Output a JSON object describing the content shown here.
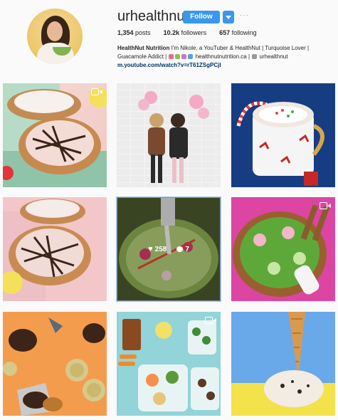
{
  "profile": {
    "username": "urhealthnut",
    "follow_label": "Follow",
    "more_label": "···",
    "stats": {
      "posts_count": "1,354",
      "posts_label": "posts",
      "followers_count": "10.2k",
      "followers_label": "followers",
      "following_count": "657",
      "following_label": "following"
    },
    "bio": {
      "name": "HealthNut Nutrition",
      "line1": "I'm Nikole, a YouTuber & HealthNut | Turquoise Lover |",
      "line2a": "Guacamole Addict |",
      "line2b": "healthnutnutrition.ca |",
      "line2c": "urhealthnut",
      "link": "m.youtube.com/watch?v=rT61ZSgPCjI"
    }
  },
  "hover_post": {
    "likes": "258",
    "comments": "7"
  },
  "colors": {
    "follow_blue": "#3897f0",
    "link_blue": "#003569"
  },
  "icons": [
    "video-icon",
    "heart-icon",
    "comment-icon",
    "chevron-down-icon"
  ]
}
